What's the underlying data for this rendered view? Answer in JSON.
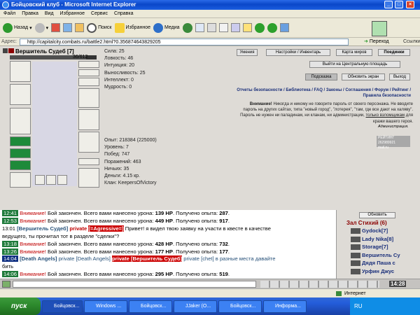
{
  "window": {
    "title": "Бойцовский клуб - Microsoft Internet Explorer"
  },
  "menu": [
    "Файл",
    "Правка",
    "Вид",
    "Избранное",
    "Сервис",
    "Справка"
  ],
  "toolbar": {
    "back": "Назад",
    "search": "Поиск",
    "favorites": "Избранное",
    "media": "Медиа"
  },
  "address": {
    "label": "Адрес:",
    "url": "http://capitalcity.combats.ru/battle2.html?0.356874643829205",
    "go": "Переход",
    "links": "Ссылки"
  },
  "character": {
    "name": "Вершитель Судеб",
    "level": "[7]",
    "hp": "36/612",
    "hp_fraction": 0.059
  },
  "stats": [
    "Сила: 25",
    "Ловкость: 46",
    "Интуиция: 20",
    "Выносливость: 25",
    "Интеллект: 0",
    "Мудрость: 0"
  ],
  "stats2": [
    "Опыт: 218384 (225000)",
    "Уровень: 7",
    "Побед: 747",
    "Поражений: 463",
    "Ничьих: 35",
    "Деньги: 4.15 кр.",
    "Клан: KeepersOfVictory"
  ],
  "buttons": {
    "skills": "Умения",
    "settings": "Настройки / Инвентарь",
    "map": "Карта миров",
    "fights": "Поединки",
    "exit_square": "Выйти на Центральную площадь",
    "hint": "Подсказка",
    "refresh_screen": "Обновить экран",
    "exit": "Выход"
  },
  "links_line1": "Отчеты безопасности / Библиотека / FAQ / Законы / Соглашения / Форум / Рейтинг /",
  "links_line2": "Правила безопасности",
  "warning": {
    "title": "Внимание!",
    "text1": "Никогда и никому не говорите пароль от своего персонажа. Не вводите",
    "text2": "пароль на других сайтах, типа \"новый город\", \"лотерея\", \"там, где все дают на халяву\".",
    "text3": "Пароль не нужен ни паладинам, ни кланам, ни администрации,",
    "text3b": "только взломщикам",
    "text3c": "для",
    "text4": "кражи вашего героя.",
    "admin": "Администрация."
  },
  "counter": {
    "line1": "РЕЙТИНГ 262989921",
    "line2": "mail.ru"
  },
  "chat": [
    {
      "time": "12:41",
      "t": "g",
      "w": "Внимание!",
      "m": " Бой закончен. Всего вами нанесено урона: ",
      "v1": "139 HP",
      "m2": ". Получено опыта: ",
      "v2": "287",
      "end": "."
    },
    {
      "time": "12:53",
      "t": "g",
      "w": "Внимание!",
      "m": " Бой закончен. Всего вами нанесено урона: ",
      "v1": "449 HP",
      "m2": ". Получено опыта: ",
      "v2": "917",
      "end": "."
    },
    {
      "time": "13:01",
      "t": "n",
      "from": "[Вершитель Судеб]",
      "priv": "private",
      "to": "[=Agressive=]",
      "msg": " Привет! я видел твою заявку на участи в квесте в качестве"
    },
    {
      "cont": "ведущего, ты прочитал тот в разделе \"сделки\"?"
    },
    {
      "time": "13:18",
      "t": "g",
      "w": "Внимание!",
      "m": " Бой закончен. Всего вами нанесено урона: ",
      "v1": "428 HP",
      "m2": ". Получено опыта: ",
      "v2": "732",
      "end": "."
    },
    {
      "time": "13:26",
      "t": "g",
      "w": "Внимание!",
      "m": " Бой закончен. Всего вами нанесено урона: ",
      "v1": "177 HP",
      "m2": ". Получено опыта: ",
      "v2": "177",
      "end": "."
    },
    {
      "time": "14:04",
      "t": "p",
      "from": "[Death Angels]",
      "priv": "private [Death Angels]",
      "to": "private [Вершитель Судеб]",
      "msg": " private [chet] в разные места давайте"
    },
    {
      "cont": "бить"
    },
    {
      "time": "14:06",
      "t": "g",
      "w": "Внимание!",
      "m": " Бой закончен. Всего вами нанесено урона: ",
      "v1": "295 HP",
      "m2": ". Получено опыта: ",
      "v2": "519",
      "end": "."
    },
    {
      "time": "14:25",
      "t": "g",
      "w": "Внимание!",
      "m": " Бой закончен. Всего вами нанесено урона: ",
      "v1": "177 HP",
      "m2": ". Получено опыта: ",
      "v2": "336",
      "end": "."
    }
  ],
  "side": {
    "refresh": "Обновить",
    "room": "Зал Стихий (6)",
    "players": [
      "Gydock[7]",
      "Lady Nika[8]",
      "Storage[7]",
      "Вершитель Су",
      "Дядя Паша с",
      "Урфин Джус"
    ]
  },
  "status": {
    "zone": "Интернет"
  },
  "clock": "14:28",
  "taskbar": {
    "start": "пуск",
    "tasks": [
      "Бойцовск...",
      "Windows ...",
      "Бойцовск...",
      "JJaker (О...",
      "Бойцовск...",
      "Информа..."
    ],
    "lang": "RU"
  }
}
